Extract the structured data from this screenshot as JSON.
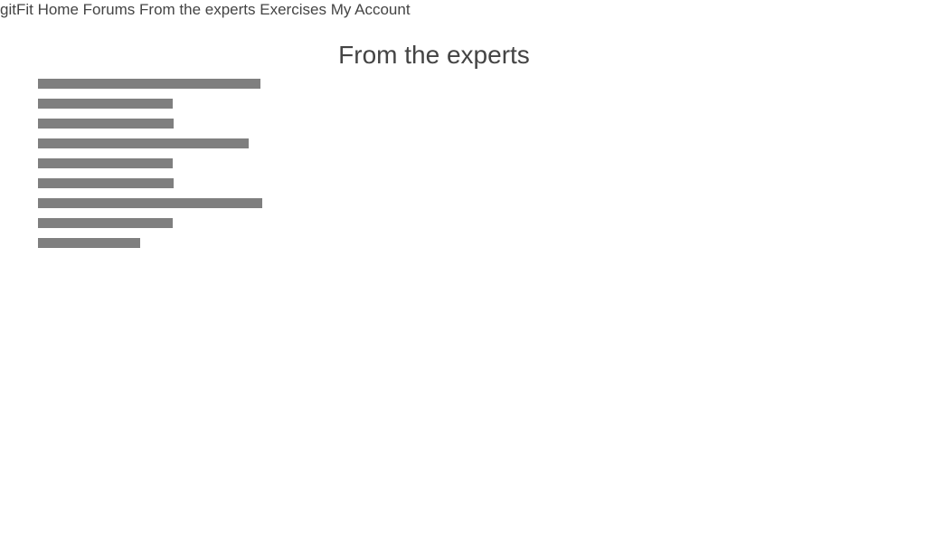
{
  "nav": {
    "items": [
      {
        "label": "gitFit"
      },
      {
        "label": "Home"
      },
      {
        "label": "Forums"
      },
      {
        "label": "From the experts"
      },
      {
        "label": "Exercises"
      },
      {
        "label": "My Account"
      }
    ]
  },
  "page": {
    "title": "From the experts"
  },
  "colors": {
    "text": "#444444",
    "placeholder_bar": "#7f7f7f",
    "background": "#ffffff"
  }
}
